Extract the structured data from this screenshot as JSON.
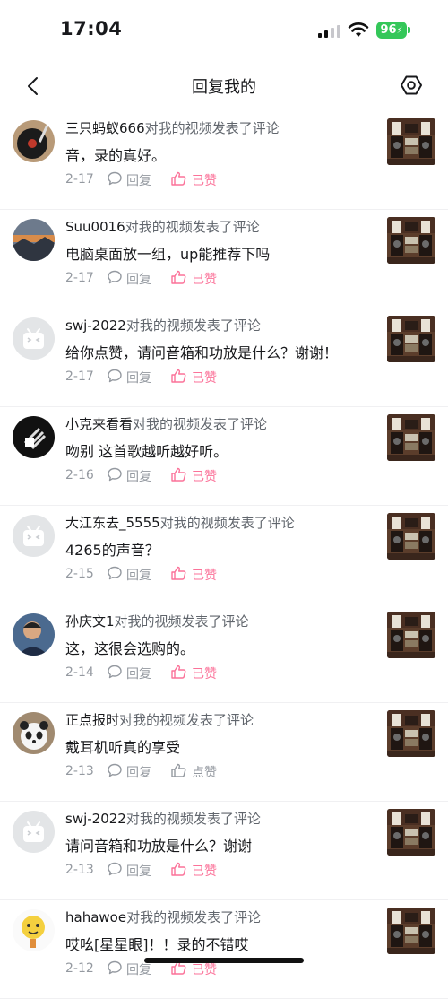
{
  "status_bar": {
    "time": "17:04",
    "battery": "96"
  },
  "nav": {
    "title": "回复我的"
  },
  "colors": {
    "accent_pink": "#fb7299",
    "meta_gray": "#9499a0",
    "battery_green": "#34c759"
  },
  "comments": [
    {
      "user": "三只蚂蚁666",
      "action": "对我的视频发表了评论",
      "text": "音，录的真好。",
      "date": "2-17",
      "reply_label": "回复",
      "like_label": "已赞",
      "liked": true,
      "avatar": "record-player"
    },
    {
      "user": "Suu0016",
      "action": "对我的视频发表了评论",
      "text": "电脑桌面放一组，up能推荐下吗",
      "date": "2-17",
      "reply_label": "回复",
      "like_label": "已赞",
      "liked": true,
      "avatar": "sunset"
    },
    {
      "user": "swj-2022",
      "action": "对我的视频发表了评论",
      "text": "给你点赞，请问音箱和功放是什么？谢谢！",
      "date": "2-17",
      "reply_label": "回复",
      "like_label": "已赞",
      "liked": true,
      "avatar": "default-tv"
    },
    {
      "user": "小克来看看",
      "action": "对我的视频发表了评论",
      "text": "吻别 这首歌越听越好听。",
      "date": "2-16",
      "reply_label": "回复",
      "like_label": "已赞",
      "liked": true,
      "avatar": "dark-photo"
    },
    {
      "user": "大江东去_5555",
      "action": "对我的视频发表了评论",
      "text": "4265的声音？",
      "date": "2-15",
      "reply_label": "回复",
      "like_label": "已赞",
      "liked": true,
      "avatar": "default-tv"
    },
    {
      "user": "孙庆文1",
      "action": "对我的视频发表了评论",
      "text": "这，这很会选购的。",
      "date": "2-14",
      "reply_label": "回复",
      "like_label": "已赞",
      "liked": true,
      "avatar": "portrait"
    },
    {
      "user": "正点报时",
      "action": "对我的视频发表了评论",
      "text": "戴耳机听真的享受",
      "date": "2-13",
      "reply_label": "回复",
      "like_label": "点赞",
      "liked": false,
      "avatar": "panda"
    },
    {
      "user": "swj-2022",
      "action": "对我的视频发表了评论",
      "text": "请问音箱和功放是什么？谢谢",
      "date": "2-13",
      "reply_label": "回复",
      "like_label": "已赞",
      "liked": true,
      "avatar": "default-tv"
    },
    {
      "user": "hahawoe",
      "action": "对我的视频发表了评论",
      "text": "哎吆[星星眼]！！录的不错哎",
      "date": "2-12",
      "reply_label": "回复",
      "like_label": "已赞",
      "liked": true,
      "avatar": "emoji-face"
    }
  ]
}
